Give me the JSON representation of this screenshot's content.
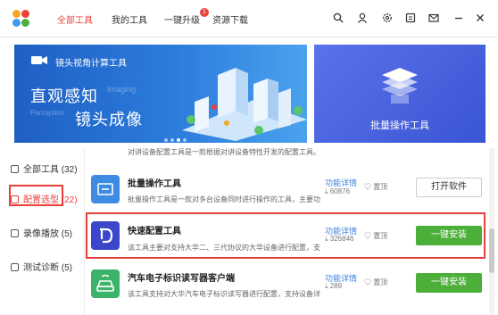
{
  "nav": {
    "all_tools": "全部工具",
    "my_tools": "我的工具",
    "upgrade": "一键升级",
    "upgrade_badge": "1",
    "downloads": "资源下载"
  },
  "banner": {
    "left_title": "镜头视角计算工具",
    "left_headline_1": "直观感知",
    "left_headline_2": "镜头成像",
    "left_en_1": "Imaging",
    "left_en_2": "Perception",
    "right_title": "批量操作工具"
  },
  "sidebar": {
    "items": [
      {
        "label": "全部工具 (32)"
      },
      {
        "label": "配置选型 (22)"
      },
      {
        "label": "录像播放 (5)"
      },
      {
        "label": "测试诊断 (5)"
      }
    ]
  },
  "list": {
    "partial_desc": "对讲设备配置工具是一款根据对讲设备特性开发的配置工具。",
    "rows": [
      {
        "title": "批量操作工具",
        "desc": "批量操作工具是一款对多台设备同时进行操作的工具，主要功",
        "detail": "功能详情",
        "count": "60876",
        "pin": "置顶",
        "action": "打开软件"
      },
      {
        "title": "快速配置工具",
        "desc": "该工具主要对支持大华二、三代协议的大华设备进行配置，支",
        "detail": "功能详情",
        "count": "326846",
        "pin": "置顶",
        "action": "一键安装"
      },
      {
        "title": "汽车电子标识读写器客户端",
        "desc": "该工具支持对大华汽车电子标识读写器进行配置，支持设备详",
        "detail": "功能详情",
        "count": "289",
        "pin": "置顶",
        "action": "一键安装"
      }
    ]
  },
  "colors": {
    "accent": "#e8413c",
    "link": "#3d7fe0",
    "install_green": "#4caf3a"
  },
  "icons": [
    "app-logo-icon",
    "search-icon",
    "user-icon",
    "settings-icon",
    "feedback-icon",
    "message-icon",
    "minimize-icon",
    "close-icon"
  ]
}
